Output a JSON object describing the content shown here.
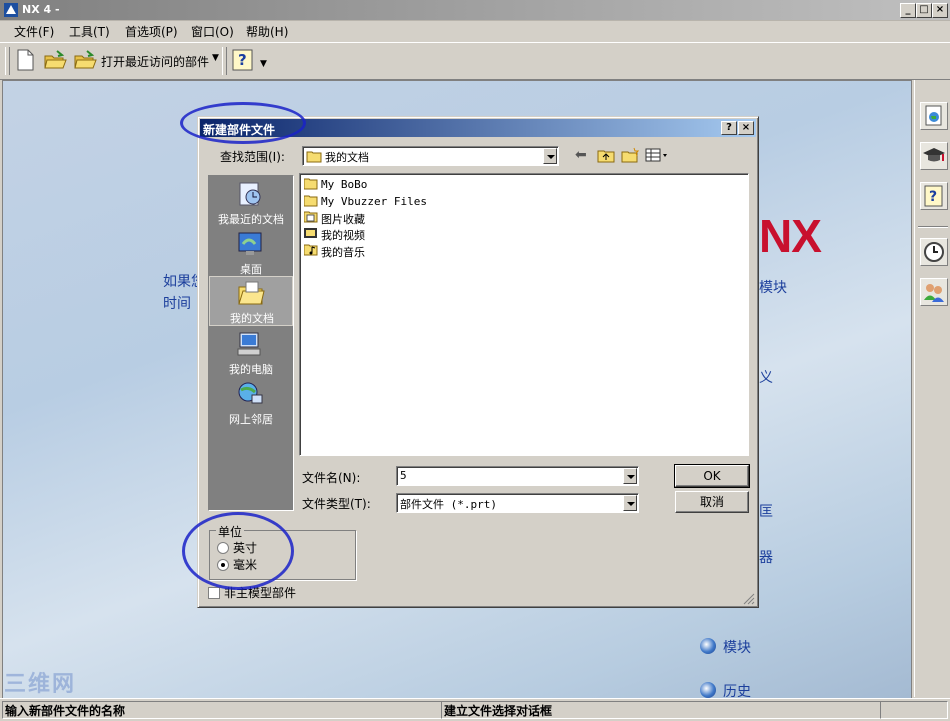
{
  "window": {
    "title": "NX 4 -"
  },
  "menu": [
    "文件(F)",
    "工具(T)",
    "首选项(P)",
    "窗口(O)",
    "帮助(H)"
  ],
  "toolbar": {
    "recent_label": "打开最近访问的部件"
  },
  "background": {
    "intro_line1": "如果您",
    "intro_line2": "时间",
    "logo": "NX",
    "right_text_1": "模块",
    "right_text_2": "义",
    "right_text_3": "匡",
    "right_text_4": "器",
    "link_modules": "模块",
    "link_history": "历史"
  },
  "dialog": {
    "title": "新建部件文件",
    "help_btn": "?",
    "close_btn": "×",
    "lookin_label": "查找范围(I):",
    "lookin_value": "我的文档",
    "places": [
      {
        "label": "我最近的文档",
        "icon": "recent-documents-icon"
      },
      {
        "label": "桌面",
        "icon": "desktop-icon"
      },
      {
        "label": "我的文档",
        "icon": "my-documents-icon"
      },
      {
        "label": "我的电脑",
        "icon": "my-computer-icon"
      },
      {
        "label": "网上邻居",
        "icon": "network-places-icon"
      }
    ],
    "files": [
      {
        "name": "My BoBo",
        "icon": "folder-icon"
      },
      {
        "name": "My Vbuzzer Files",
        "icon": "folder-icon"
      },
      {
        "name": "图片收藏",
        "icon": "pictures-folder-icon"
      },
      {
        "name": "我的视频",
        "icon": "videos-folder-icon"
      },
      {
        "name": "我的音乐",
        "icon": "music-folder-icon"
      }
    ],
    "filename_label": "文件名(N):",
    "filename_value": "5",
    "filetype_label": "文件类型(T):",
    "filetype_value": "部件文件 (*.prt)",
    "ok_label": "OK",
    "cancel_label": "取消",
    "units_label": "单位",
    "unit_inch": "英寸",
    "unit_mm": "毫米",
    "units_selected": "毫米",
    "nonmaster_label": "非主模型部件"
  },
  "status": {
    "left": "输入新部件文件的名称",
    "right": "建立文件选择对话框"
  },
  "watermark": "三维网",
  "colors": {
    "title_gradient_start": "#0a246a",
    "title_gradient_end": "#a6caf0",
    "nx_red": "#c8102e",
    "annotation_blue": "#1a22c8"
  }
}
